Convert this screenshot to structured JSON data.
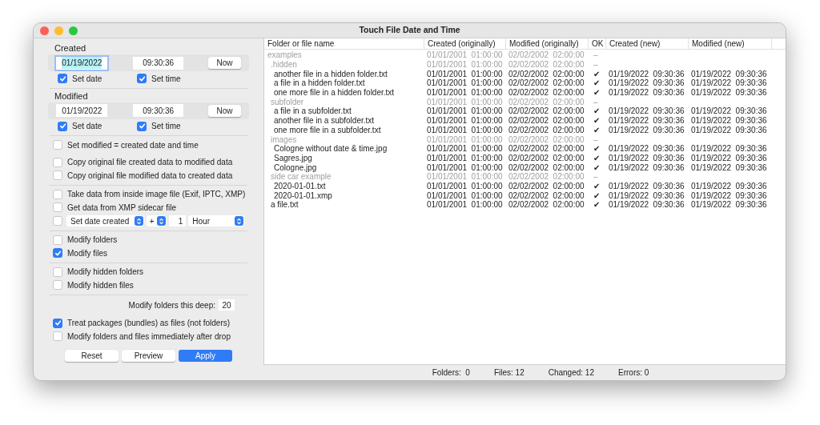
{
  "window": {
    "title": "Touch File Date and Time"
  },
  "date_groups": [
    {
      "label": "Created",
      "date": "01/19/2022",
      "time": "09:30:36",
      "date_focused": true,
      "now_button": "Now",
      "set_date": {
        "label": "Set date",
        "checked": true
      },
      "set_time": {
        "label": "Set time",
        "checked": true
      }
    },
    {
      "label": "Modified",
      "date": "01/19/2022",
      "time": "09:30:36",
      "date_focused": false,
      "now_button": "Now",
      "set_date": {
        "label": "Set date",
        "checked": true
      },
      "set_time": {
        "label": "Set time",
        "checked": true
      }
    }
  ],
  "option_groups": [
    [
      {
        "kind": "checkbox",
        "label": "Set modified = created date and time",
        "checked": false
      },
      {
        "kind": "spacer"
      },
      {
        "kind": "checkbox",
        "label": "Copy original file created data to modified data",
        "checked": false
      },
      {
        "kind": "checkbox",
        "label": "Copy original file modified data to created data",
        "checked": false
      }
    ],
    [
      {
        "kind": "checkbox",
        "label": "Take data from inside image file (Exif, IPTC, XMP)",
        "checked": false
      },
      {
        "kind": "checkbox",
        "label": "Get data from XMP sidecar file",
        "checked": false
      },
      {
        "kind": "offset",
        "checked": false,
        "field": "Set date created",
        "sign": "+",
        "amount": "1",
        "unit": "Hour"
      }
    ],
    [
      {
        "kind": "checkbox",
        "label": "Modify folders",
        "checked": false
      },
      {
        "kind": "checkbox",
        "label": "Modify files",
        "checked": true
      }
    ],
    [
      {
        "kind": "checkbox",
        "label": "Modify hidden folders",
        "checked": false
      },
      {
        "kind": "checkbox",
        "label": "Modify hidden files",
        "checked": false
      }
    ],
    [
      {
        "kind": "number",
        "label": "Modify folders this deep:",
        "value": "20"
      },
      {
        "kind": "spacer"
      },
      {
        "kind": "checkbox",
        "label": "Treat packages (bundles) as files (not folders)",
        "checked": true
      },
      {
        "kind": "checkbox",
        "label": "Modify folders and files immediately after drop",
        "checked": false
      }
    ]
  ],
  "buttons": [
    {
      "label": "Reset",
      "primary": false
    },
    {
      "label": "Preview",
      "primary": false
    },
    {
      "label": "Apply",
      "primary": true
    }
  ],
  "table": {
    "columns": [
      "Folder or file name",
      "Created (originally)",
      "Modified (originally)",
      "OK",
      "Created (new)",
      "Modified (new)"
    ],
    "rows": [
      {
        "kind": "folder",
        "name": "examples",
        "created_orig": "01/01/2001  01:00:00",
        "modified_orig": "02/02/2002  02:00:00",
        "ok": "–",
        "children": [
          {
            "kind": "folder",
            "name": ".hidden",
            "created_orig": "01/01/2001  01:00:00",
            "modified_orig": "02/02/2002  02:00:00",
            "ok": "–",
            "children": [
              {
                "kind": "file",
                "name": "another file in a hidden folder.txt",
                "created_orig": "01/01/2001  01:00:00",
                "modified_orig": "02/02/2002  02:00:00",
                "ok": "✔",
                "created_new": "01/19/2022  09:30:36",
                "modified_new": "01/19/2022  09:30:36"
              },
              {
                "kind": "file",
                "name": "a file in a hidden folder.txt",
                "created_orig": "01/01/2001  01:00:00",
                "modified_orig": "02/02/2002  02:00:00",
                "ok": "✔",
                "created_new": "01/19/2022  09:30:36",
                "modified_new": "01/19/2022  09:30:36"
              },
              {
                "kind": "file",
                "name": "one more file in a hidden folder.txt",
                "created_orig": "01/01/2001  01:00:00",
                "modified_orig": "02/02/2002  02:00:00",
                "ok": "✔",
                "created_new": "01/19/2022  09:30:36",
                "modified_new": "01/19/2022  09:30:36"
              }
            ]
          },
          {
            "kind": "folder",
            "name": "subfolder",
            "created_orig": "01/01/2001  01:00:00",
            "modified_orig": "02/02/2002  02:00:00",
            "ok": "–",
            "children": [
              {
                "kind": "file",
                "name": "a file in a subfolder.txt",
                "created_orig": "01/01/2001  01:00:00",
                "modified_orig": "02/02/2002  02:00:00",
                "ok": "✔",
                "created_new": "01/19/2022  09:30:36",
                "modified_new": "01/19/2022  09:30:36"
              },
              {
                "kind": "file",
                "name": "another file in a subfolder.txt",
                "created_orig": "01/01/2001  01:00:00",
                "modified_orig": "02/02/2002  02:00:00",
                "ok": "✔",
                "created_new": "01/19/2022  09:30:36",
                "modified_new": "01/19/2022  09:30:36"
              },
              {
                "kind": "file",
                "name": "one more file in a subfolder.txt",
                "created_orig": "01/01/2001  01:00:00",
                "modified_orig": "02/02/2002  02:00:00",
                "ok": "✔",
                "created_new": "01/19/2022  09:30:36",
                "modified_new": "01/19/2022  09:30:36"
              }
            ]
          },
          {
            "kind": "folder",
            "name": "images",
            "created_orig": "01/01/2001  01:00:00",
            "modified_orig": "02/02/2002  02:00:00",
            "ok": "–",
            "children": [
              {
                "kind": "file",
                "name": "Cologne without date & time.jpg",
                "created_orig": "01/01/2001  01:00:00",
                "modified_orig": "02/02/2002  02:00:00",
                "ok": "✔",
                "created_new": "01/19/2022  09:30:36",
                "modified_new": "01/19/2022  09:30:36"
              },
              {
                "kind": "file",
                "name": "Sagres.jpg",
                "created_orig": "01/01/2001  01:00:00",
                "modified_orig": "02/02/2002  02:00:00",
                "ok": "✔",
                "created_new": "01/19/2022  09:30:36",
                "modified_new": "01/19/2022  09:30:36"
              },
              {
                "kind": "file",
                "name": "Cologne.jpg",
                "created_orig": "01/01/2001  01:00:00",
                "modified_orig": "02/02/2002  02:00:00",
                "ok": "✔",
                "created_new": "01/19/2022  09:30:36",
                "modified_new": "01/19/2022  09:30:36"
              }
            ]
          },
          {
            "kind": "folder",
            "name": "side car example",
            "created_orig": "01/01/2001  01:00:00",
            "modified_orig": "02/02/2002  02:00:00",
            "ok": "–",
            "children": [
              {
                "kind": "file",
                "name": "2020-01-01.txt",
                "created_orig": "01/01/2001  01:00:00",
                "modified_orig": "02/02/2002  02:00:00",
                "ok": "✔",
                "created_new": "01/19/2022  09:30:36",
                "modified_new": "01/19/2022  09:30:36"
              },
              {
                "kind": "file",
                "name": "2020-01-01.xmp",
                "created_orig": "01/01/2001  01:00:00",
                "modified_orig": "02/02/2002  02:00:00",
                "ok": "✔",
                "created_new": "01/19/2022  09:30:36",
                "modified_new": "01/19/2022  09:30:36"
              }
            ]
          },
          {
            "kind": "file",
            "name": "a file.txt",
            "created_orig": "01/01/2001  01:00:00",
            "modified_orig": "02/02/2002  02:00:00",
            "ok": "✔",
            "created_new": "01/19/2022  09:30:36",
            "modified_new": "01/19/2022  09:30:36"
          }
        ]
      }
    ]
  },
  "status_bar": [
    "Folders:  0",
    "Files: 12",
    "Changed: 12",
    "Errors: 0"
  ]
}
